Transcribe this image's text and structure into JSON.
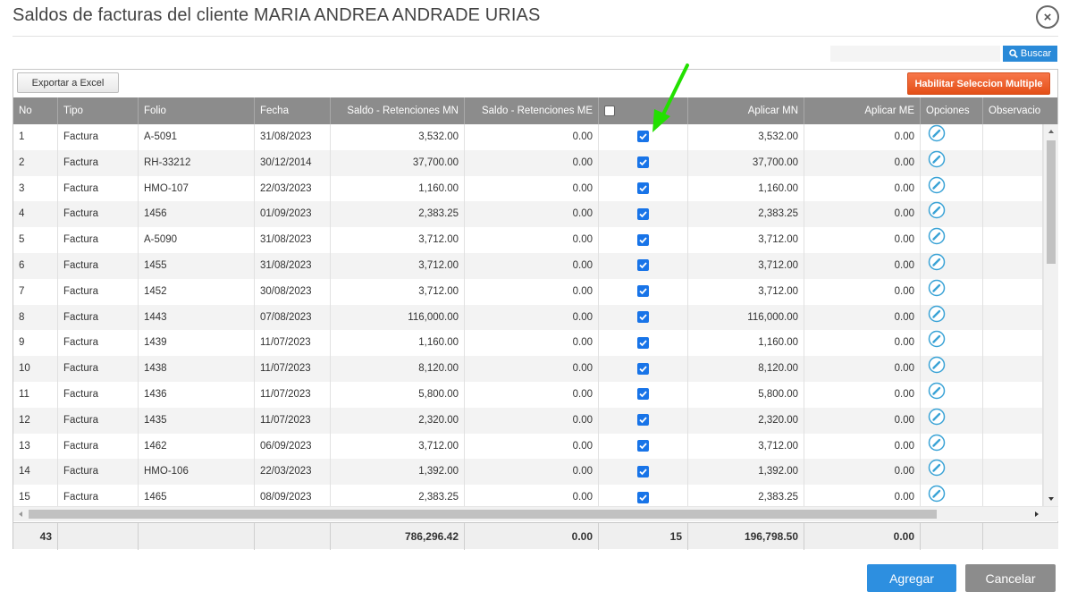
{
  "dialog": {
    "title": "Saldos de facturas del cliente MARIA ANDREA ANDRADE URIAS",
    "close_icon": "×"
  },
  "search": {
    "value": "",
    "placeholder": "",
    "button_label": "Buscar"
  },
  "toolbar": {
    "export_label": "Exportar a Excel",
    "multi_select_label": "Habilitar Seleccion Multiple"
  },
  "columns": {
    "no": "No",
    "tipo": "Tipo",
    "folio": "Folio",
    "fecha": "Fecha",
    "saldo_mn": "Saldo - Retenciones MN",
    "saldo_me": "Saldo - Retenciones ME",
    "aplicar_mn": "Aplicar MN",
    "aplicar_me": "Aplicar ME",
    "opciones": "Opciones",
    "observaciones": "Observacio"
  },
  "rows": [
    {
      "no": "1",
      "tipo": "Factura",
      "folio": "A-5091",
      "fecha": "31/08/2023",
      "saldo_mn": "3,532.00",
      "saldo_me": "0.00",
      "checked": true,
      "aplicar_mn": "3,532.00",
      "aplicar_me": "0.00"
    },
    {
      "no": "2",
      "tipo": "Factura",
      "folio": "RH-33212",
      "fecha": "30/12/2014",
      "saldo_mn": "37,700.00",
      "saldo_me": "0.00",
      "checked": true,
      "aplicar_mn": "37,700.00",
      "aplicar_me": "0.00"
    },
    {
      "no": "3",
      "tipo": "Factura",
      "folio": "HMO-107",
      "fecha": "22/03/2023",
      "saldo_mn": "1,160.00",
      "saldo_me": "0.00",
      "checked": true,
      "aplicar_mn": "1,160.00",
      "aplicar_me": "0.00"
    },
    {
      "no": "4",
      "tipo": "Factura",
      "folio": "1456",
      "fecha": "01/09/2023",
      "saldo_mn": "2,383.25",
      "saldo_me": "0.00",
      "checked": true,
      "aplicar_mn": "2,383.25",
      "aplicar_me": "0.00"
    },
    {
      "no": "5",
      "tipo": "Factura",
      "folio": "A-5090",
      "fecha": "31/08/2023",
      "saldo_mn": "3,712.00",
      "saldo_me": "0.00",
      "checked": true,
      "aplicar_mn": "3,712.00",
      "aplicar_me": "0.00"
    },
    {
      "no": "6",
      "tipo": "Factura",
      "folio": "1455",
      "fecha": "31/08/2023",
      "saldo_mn": "3,712.00",
      "saldo_me": "0.00",
      "checked": true,
      "aplicar_mn": "3,712.00",
      "aplicar_me": "0.00"
    },
    {
      "no": "7",
      "tipo": "Factura",
      "folio": "1452",
      "fecha": "30/08/2023",
      "saldo_mn": "3,712.00",
      "saldo_me": "0.00",
      "checked": true,
      "aplicar_mn": "3,712.00",
      "aplicar_me": "0.00"
    },
    {
      "no": "8",
      "tipo": "Factura",
      "folio": "1443",
      "fecha": "07/08/2023",
      "saldo_mn": "116,000.00",
      "saldo_me": "0.00",
      "checked": true,
      "aplicar_mn": "116,000.00",
      "aplicar_me": "0.00"
    },
    {
      "no": "9",
      "tipo": "Factura",
      "folio": "1439",
      "fecha": "11/07/2023",
      "saldo_mn": "1,160.00",
      "saldo_me": "0.00",
      "checked": true,
      "aplicar_mn": "1,160.00",
      "aplicar_me": "0.00"
    },
    {
      "no": "10",
      "tipo": "Factura",
      "folio": "1438",
      "fecha": "11/07/2023",
      "saldo_mn": "8,120.00",
      "saldo_me": "0.00",
      "checked": true,
      "aplicar_mn": "8,120.00",
      "aplicar_me": "0.00"
    },
    {
      "no": "11",
      "tipo": "Factura",
      "folio": "1436",
      "fecha": "11/07/2023",
      "saldo_mn": "5,800.00",
      "saldo_me": "0.00",
      "checked": true,
      "aplicar_mn": "5,800.00",
      "aplicar_me": "0.00"
    },
    {
      "no": "12",
      "tipo": "Factura",
      "folio": "1435",
      "fecha": "11/07/2023",
      "saldo_mn": "2,320.00",
      "saldo_me": "0.00",
      "checked": true,
      "aplicar_mn": "2,320.00",
      "aplicar_me": "0.00"
    },
    {
      "no": "13",
      "tipo": "Factura",
      "folio": "1462",
      "fecha": "06/09/2023",
      "saldo_mn": "3,712.00",
      "saldo_me": "0.00",
      "checked": true,
      "aplicar_mn": "3,712.00",
      "aplicar_me": "0.00"
    },
    {
      "no": "14",
      "tipo": "Factura",
      "folio": "HMO-106",
      "fecha": "22/03/2023",
      "saldo_mn": "1,392.00",
      "saldo_me": "0.00",
      "checked": true,
      "aplicar_mn": "1,392.00",
      "aplicar_me": "0.00"
    },
    {
      "no": "15",
      "tipo": "Factura",
      "folio": "1465",
      "fecha": "08/09/2023",
      "saldo_mn": "2,383.25",
      "saldo_me": "0.00",
      "checked": true,
      "aplicar_mn": "2,383.25",
      "aplicar_me": "0.00"
    }
  ],
  "totals": {
    "count": "43",
    "saldo_mn": "786,296.42",
    "saldo_me": "0.00",
    "selected": "15",
    "aplicar_mn": "196,798.50",
    "aplicar_me": "0.00"
  },
  "actions": {
    "add_label": "Agregar",
    "cancel_label": "Cancelar"
  },
  "colors": {
    "header_bg": "#8c8c8c",
    "primary_button": "#2d8fe0",
    "multi_select_button": "#e8561f",
    "cancel_button": "#8c8c8c",
    "checkbox": "#1874e8",
    "edit_icon": "#3aa3d6",
    "annotation_arrow": "#22e000"
  },
  "icons": {
    "search": "search-icon",
    "close": "close-icon",
    "edit": "pencil-icon",
    "checkbox": "checkbox-checked-icon"
  }
}
